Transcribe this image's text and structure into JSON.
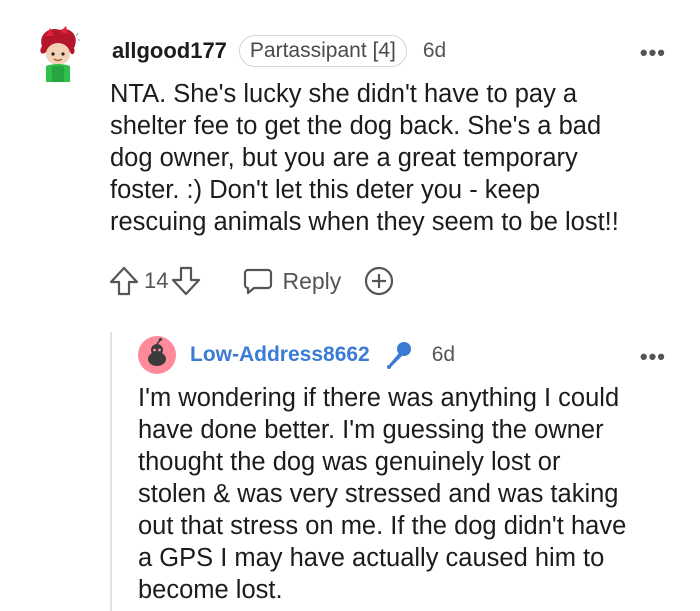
{
  "comment1": {
    "username": "allgood177",
    "flair": "Partassipant [4]",
    "age": "6d",
    "more": "•••",
    "body": "NTA. She's lucky she didn't have to pay a\nshelter fee to get the dog back. She's a bad\ndog owner, but you are a great temporary\nfoster. :) Don't let this deter you - keep\nrescuing animals when they seem to be lost!!",
    "upvotes": "14",
    "reply_label": "Reply"
  },
  "comment2": {
    "username": "Low-Address8662",
    "age": "6d",
    "more": "•••",
    "body": "I'm wondering if there was anything I could\nhave done better. I'm guessing the owner\nthought the dog was genuinely lost or\nstolen & was very stressed and was taking\nout that stress on me. If the dog didn't have\na GPS I may have actually caused him to\nbecome lost."
  },
  "colors": {
    "username_link": "#3a7bd5",
    "mic_icon": "#3a7bd5",
    "avatar2_bg": "#ff6b81"
  }
}
